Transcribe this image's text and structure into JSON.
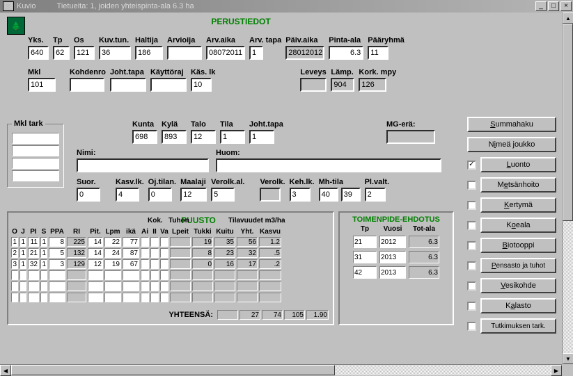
{
  "window": {
    "app": "Kuvio",
    "title": "Tietueita: 1, joiden yhteispinta-ala 6.3 ha"
  },
  "section_perus": "PERUSTIEDOT",
  "perus_labels": {
    "yks": "Yks.",
    "tp": "Tp",
    "os": "Os",
    "kuvtun": "Kuv.tun.",
    "haltija": "Haltija",
    "arvioija": "Arvioija",
    "arvaika": "Arv.aika",
    "arvtapa": "Arv. tapa",
    "paivaika": "Päiv.aika",
    "pintaala": "Pinta-ala",
    "paaryhma": "Pääryhmä",
    "mkl": "Mkl",
    "kohdenro": "Kohdenro",
    "johttapa": "Joht.tapa",
    "kayttoraj": "Käyttöraj",
    "kaslk": "Käs. lk",
    "leveys": "Leveys",
    "lamp": "Lämp.",
    "korkmpy": "Kork. mpy",
    "kunta": "Kunta",
    "kyla": "Kylä",
    "talo": "Talo",
    "tila": "Tila",
    "johttapa2": "Joht.tapa",
    "mgera": "MG-erä:",
    "nimi": "Nimi:",
    "huom": "Huom:",
    "suor": "Suor.",
    "kasvlk": "Kasv.lk.",
    "ojtilan": "Oj.tilan.",
    "maalaji": "Maalaji",
    "verolkal": "Verolk.al.",
    "verolk": "Verolk.",
    "kehlk": "Keh.lk.",
    "mhtila": "Mh-tila",
    "plvalt": "Pl.valt."
  },
  "perus": {
    "yks": "640",
    "tp": "62",
    "os": "121",
    "kuvtun": "36",
    "haltija": "186",
    "arvioija": "",
    "arvaika": "08072011",
    "arvtapa": "1",
    "paivaika": "28012012",
    "pintaala": "6.3",
    "paaryhma": "11",
    "mkl": "101",
    "kohdenro": "",
    "johttapa": "",
    "kayttoraj": "",
    "kaslk": "10",
    "leveys": "",
    "lamp": "904",
    "korkmpy": "126",
    "kunta": "698",
    "kyla": "893",
    "talo": "12",
    "tila": "1",
    "johttapa2": "1",
    "mgera": "",
    "nimi": "",
    "huom": "",
    "suor": "0",
    "kasvlk": "4",
    "ojtilan": "0",
    "maalaji": "12",
    "verolkal": "5",
    "verolk": "",
    "kehlk": "3",
    "mhtila": "40",
    "mhtila2": "39",
    "plvalt": "2"
  },
  "mkl_tark": "Mkl tark",
  "puusto": {
    "title": "PUUSTO",
    "headers": {
      "o": "O",
      "j": "J",
      "pi": "PI",
      "s": "S",
      "ppa": "PPA",
      "ri": "RI",
      "pit": "Pit.",
      "lpm": "Lpm",
      "kok": "Kok.\nikä",
      "tuhon": "Tuhon",
      "ai": "Ai",
      "ii": "II",
      "va": "Va",
      "til": "Tilavuudet m3/ha",
      "lpeit": "Lpeit",
      "tukki": "Tukki",
      "kuitu": "Kuitu",
      "yht": "Yht.",
      "kasvu": "Kasvu"
    },
    "rows": [
      {
        "o": "1",
        "j": "1",
        "pi": "11",
        "s": "1",
        "ppa": "8",
        "ri": "225",
        "pit": "14",
        "lpm": "22",
        "kok": "77",
        "lpeit": "",
        "tukki": "19",
        "kuitu": "35",
        "yht": "56",
        "kasvu": "1.2"
      },
      {
        "o": "2",
        "j": "1",
        "pi": "21",
        "s": "1",
        "ppa": "5",
        "ri": "132",
        "pit": "14",
        "lpm": "24",
        "kok": "87",
        "lpeit": "",
        "tukki": "8",
        "kuitu": "23",
        "yht": "32",
        "kasvu": ".5"
      },
      {
        "o": "3",
        "j": "1",
        "pi": "32",
        "s": "1",
        "ppa": "3",
        "ri": "129",
        "pit": "12",
        "lpm": "19",
        "kok": "67",
        "lpeit": "",
        "tukki": "0",
        "kuitu": "16",
        "yht": "17",
        "kasvu": ".2"
      }
    ],
    "yhteensa_label": "YHTEENSÄ:",
    "totals": {
      "lpeit": "",
      "tukki": "27",
      "kuitu": "74",
      "yht": "105",
      "kasvu": "1.90"
    }
  },
  "toimenpide": {
    "title": "TOIMENPIDE-EHDOTUS",
    "headers": {
      "tp": "Tp",
      "vuosi": "Vuosi",
      "totala": "Tot-ala"
    },
    "rows": [
      {
        "tp": "21",
        "vuosi": "2012",
        "totala": "6.3"
      },
      {
        "tp": "31",
        "vuosi": "2013",
        "totala": "6.3"
      },
      {
        "tp": "42",
        "vuosi": "2013",
        "totala": "6.3"
      }
    ]
  },
  "buttons": {
    "summahaku": "Summahaku",
    "nimea": "Nimeä joukko",
    "luonto": "Luonto",
    "metsanhoito": "Metsänhoito",
    "kertyma": "Kertymä",
    "koeala": "Koeala",
    "biotooppi": "Biotooppi",
    "pensasto": "Pensasto ja tuhot",
    "vesikohde": "Vesikohde",
    "kalasto": "Kalasto",
    "tutkimuksen": "Tutkimuksen tark."
  },
  "checked": {
    "luonto": "✓"
  }
}
